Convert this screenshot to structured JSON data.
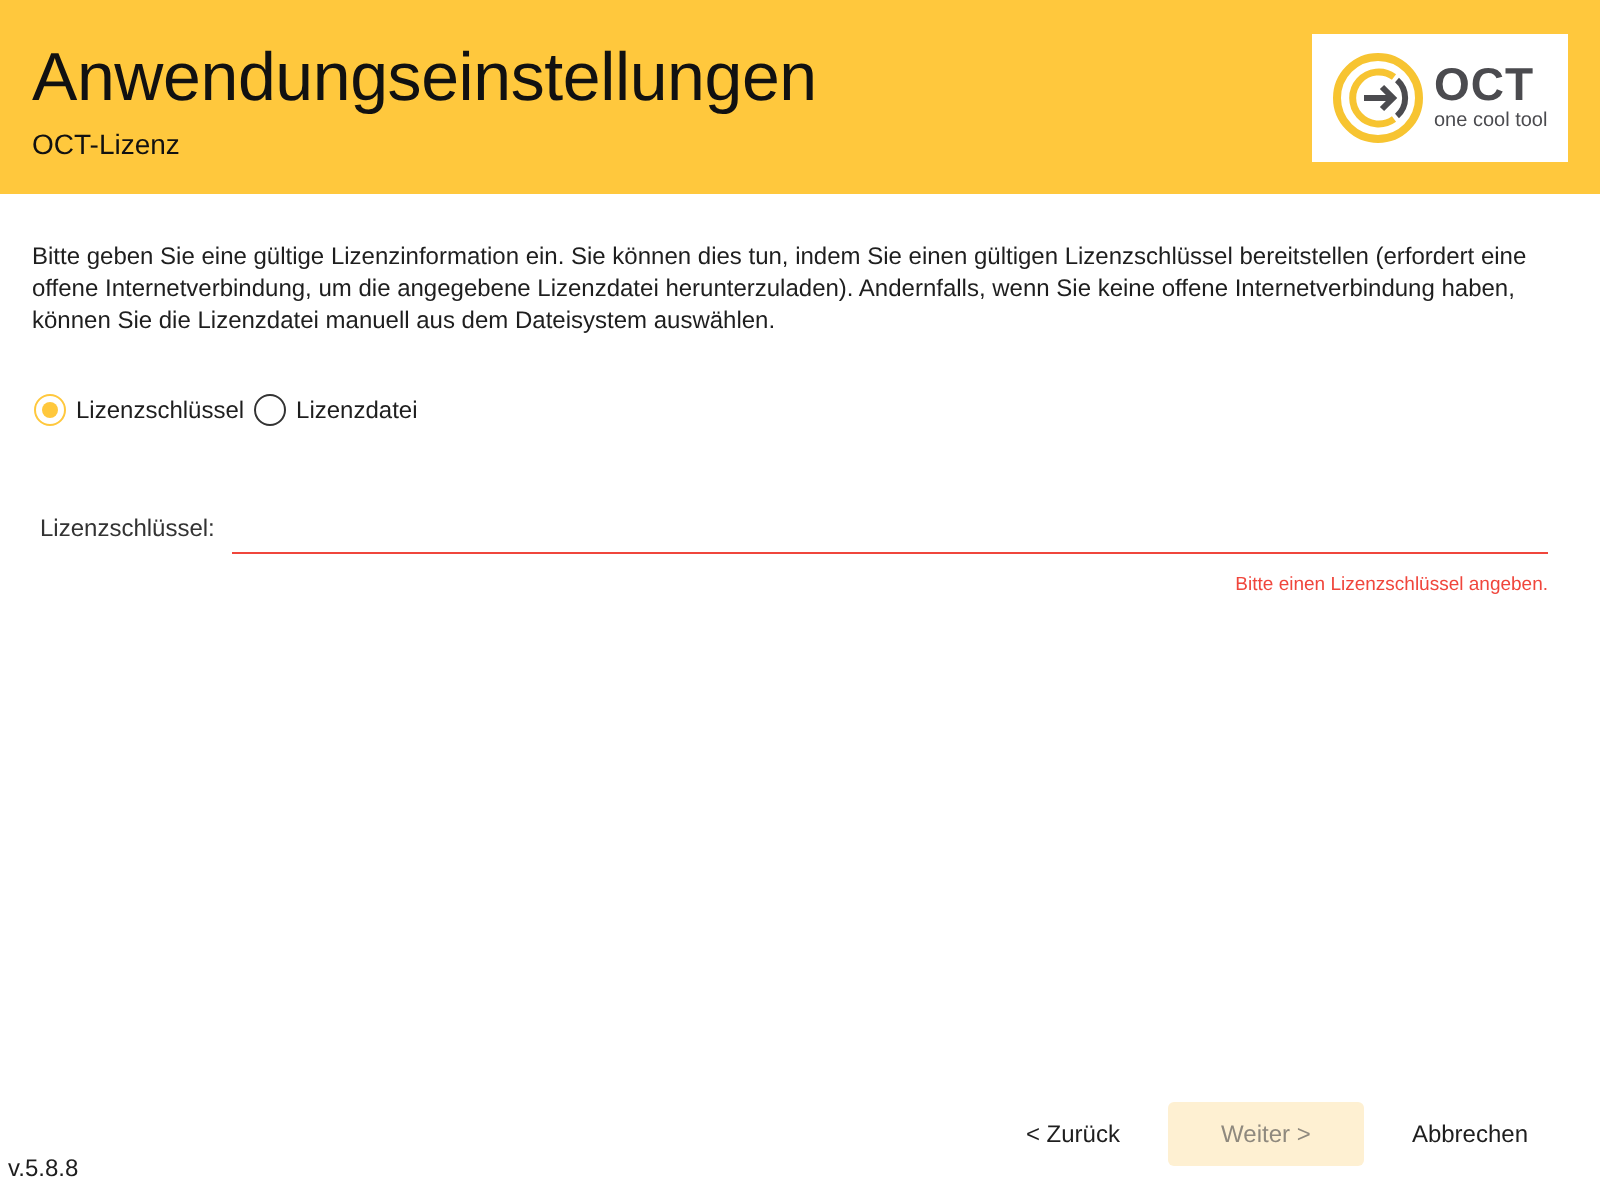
{
  "header": {
    "title": "Anwendungseinstellungen",
    "subtitle": "OCT-Lizenz",
    "logo": {
      "name": "OCT",
      "tagline": "one cool tool"
    }
  },
  "intro": "Bitte geben Sie eine gültige Lizenzinformation ein. Sie können dies tun, indem Sie einen gültigen Lizenzschlüssel bereitstellen (erfordert eine offene Internetverbindung, um die angegebene Lizenzdatei herunterzuladen). Andernfalls, wenn Sie keine offene Internetverbindung haben, können Sie die Lizenzdatei manuell aus dem Dateisystem auswählen.",
  "license_source": [
    {
      "label": "Lizenzschlüssel",
      "selected": true
    },
    {
      "label": "Lizenzdatei",
      "selected": false
    }
  ],
  "license_key_field": {
    "label": "Lizenzschlüssel:",
    "invalid": true,
    "error": "Bitte einen Lizenzschlüssel angeben."
  },
  "buttons": [
    {
      "label": "< Zurück",
      "kind": "flat",
      "disabled": false
    },
    {
      "label": "Weiter >",
      "kind": "primary",
      "disabled": true
    },
    {
      "label": "Abbrechen",
      "kind": "flat",
      "disabled": false
    }
  ],
  "version": "v.5.8.8"
}
